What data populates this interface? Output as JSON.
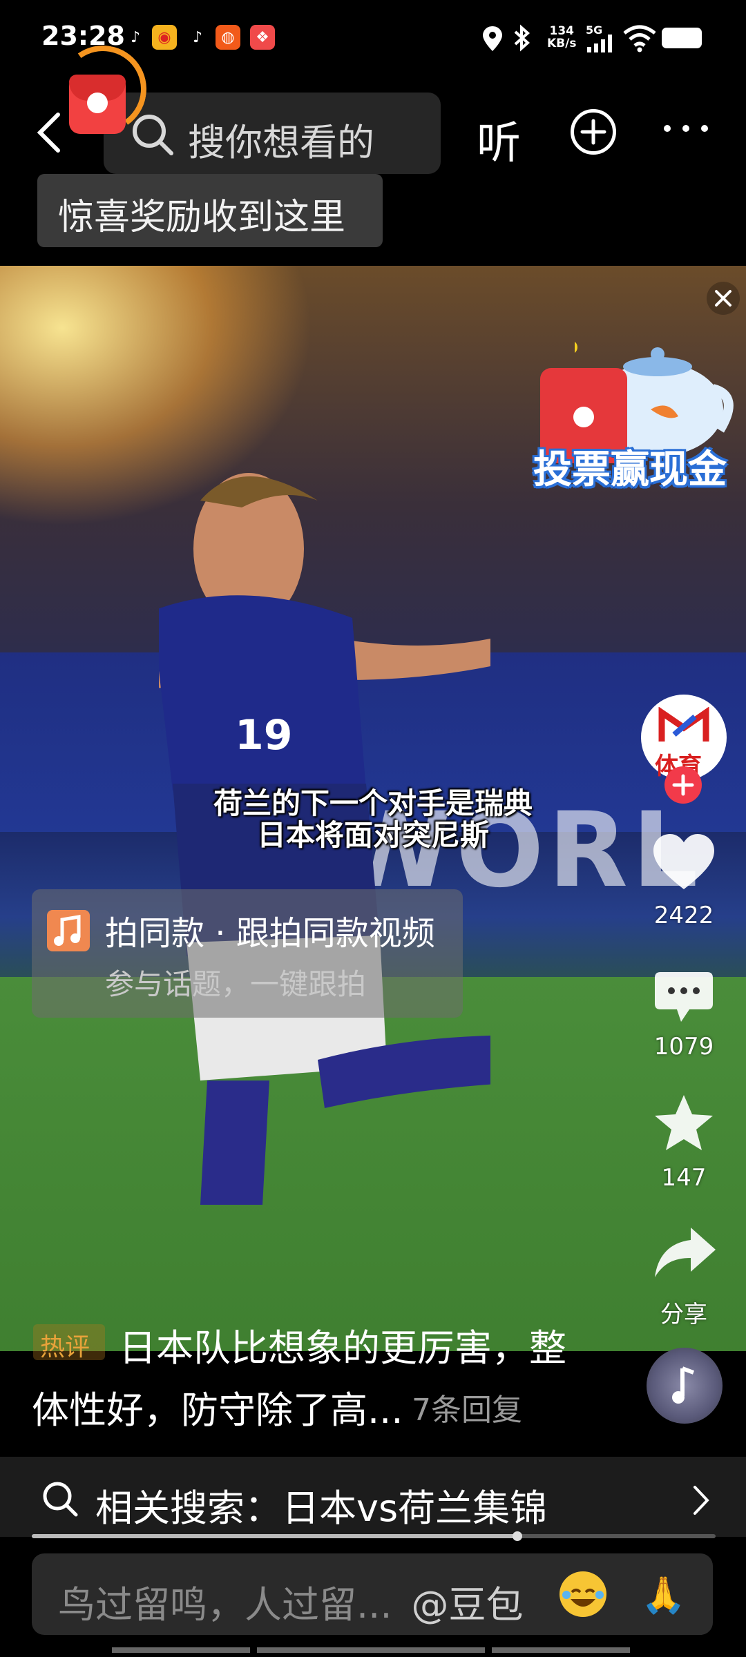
{
  "status_bar": {
    "time": "23:28",
    "network_speed": "134\nKB/s",
    "network_type": "5G",
    "app_icons": [
      "douyin-icon",
      "weibo-icon",
      "douyin-icon",
      "taobao-icon",
      "xiaohongshu-icon"
    ]
  },
  "top_nav": {
    "search_placeholder": "搜你想看的",
    "listen_label": "听",
    "tooltip": "惊喜奖励收到这里"
  },
  "video": {
    "subtitle_line1": "荷兰的下一个对手是瑞典",
    "subtitle_line2": "日本将面对突尼斯",
    "promo_label": "投票赢现金",
    "background_ad_text": "FWORL",
    "same_style": {
      "title": "拍同款 · 跟拍同款视频",
      "subtitle": "参与话题，一键跟拍"
    }
  },
  "right_rail": {
    "avatar_label": "体育",
    "likes": "2422",
    "comments": "1079",
    "favorites": "147",
    "share_label": "分享"
  },
  "hot_comment": {
    "badge": "热评",
    "line1": "日本队比想象的更厉害，整",
    "line2": "体性好，防守除了高...",
    "replies": "7条回复"
  },
  "related_search": {
    "text": "相关搜索：日本vs荷兰集锦",
    "progress": 0.71
  },
  "comment_input": {
    "placeholder": "鸟过留鸣，人过留...",
    "mention": "@豆包"
  },
  "colors": {
    "accent_red": "#f23a4a",
    "hot_badge": "#e8a23a",
    "tooltip_bg": "#3a3a3a"
  }
}
